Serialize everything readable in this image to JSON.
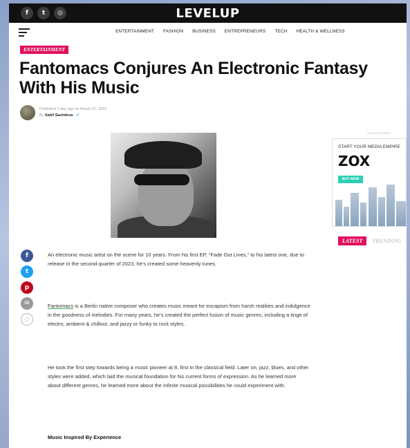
{
  "site": {
    "logo": "LEVELUP",
    "social": [
      {
        "name": "facebook-icon",
        "glyph": "f"
      },
      {
        "name": "twitter-icon",
        "glyph": "t"
      },
      {
        "name": "instagram-icon",
        "glyph": "◎"
      }
    ]
  },
  "nav": {
    "items": [
      "ENTERTAINMENT",
      "FASHION",
      "BUSINESS",
      "ENTREPRENEURS",
      "TECH",
      "HEALTH & WELLNESS"
    ]
  },
  "article": {
    "category": "ENTERTAINMENT",
    "title": "Fantomacs Conjures An Electronic Fantasy With His Music",
    "published": "Published 1 day ago on March 27, 2023",
    "by": "By",
    "author": "Sahil Sachdeva",
    "paragraphs": [
      "An electronic music artist on the scene for 10 years. From his first EP, “Fade Out Lines,” to his latest one, due to release in the second quarter of 2023, he’s created some heavenly tunes.",
      " is a Berlin native composer who creates music meant for escapism from harsh realities and indulgence in the goodness of melodies. For many years, he’s created the perfect fusion of music genres, including a tinge of electro, ambient & chillout, and jazzy or funky to rock styles.",
      "He took the first step towards being a music pioneer at 8, first in the classical field. Later on, jazz, blues, and other styles were added, which laid the musical foundation for his current forms of expression. As he learned more about different genres, he learned more about the infinite musical possibilities he could experiment with."
    ],
    "link_text": "Fantomacs",
    "subheading": "Music Inspired By Experience"
  },
  "share": [
    {
      "name": "facebook-share-icon",
      "glyph": "f",
      "color": "#3b5998"
    },
    {
      "name": "twitter-share-icon",
      "glyph": "t",
      "color": "#1da1f2"
    },
    {
      "name": "pinterest-share-icon",
      "glyph": "p",
      "color": "#bd081c"
    },
    {
      "name": "email-share-icon",
      "glyph": "✉",
      "color": "#999999"
    },
    {
      "name": "comment-share-icon",
      "glyph": "💬",
      "color": "#ffffff"
    }
  ],
  "sidebar": {
    "ad_label": "ADVERTISEMENT",
    "ad_headline": "START YOUR MEDIA EMPIRE",
    "ad_brand": "ZOX",
    "ad_cta": "BUY NOW",
    "tab_latest": "LATEST",
    "tab_trending": "TRENDING"
  }
}
